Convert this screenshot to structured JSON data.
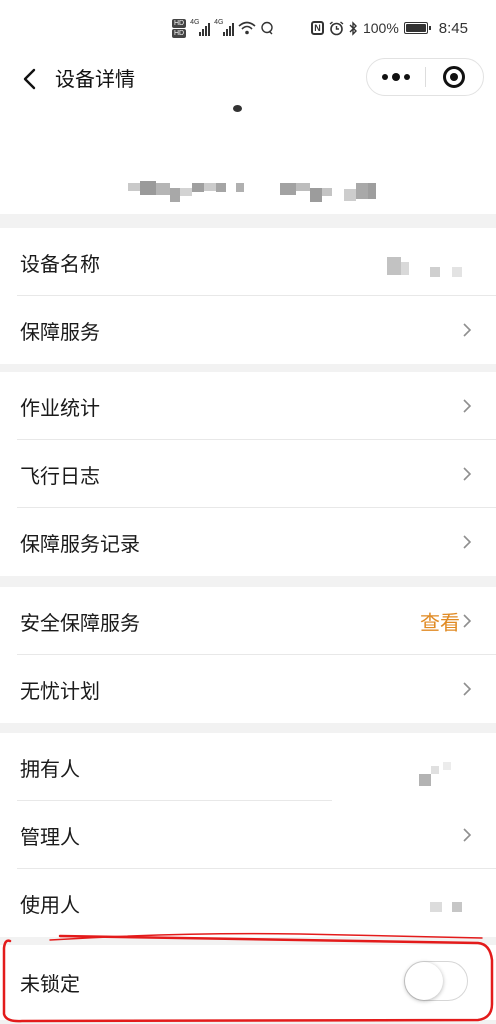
{
  "status_bar": {
    "hd_badge": "HD",
    "network_type": "4G",
    "battery_percent": "100%",
    "time": "8:45",
    "icons": [
      "hd-icon",
      "signal-icon",
      "wifi-icon",
      "nfc-icon",
      "alarm-icon",
      "bluetooth-icon",
      "battery-icon"
    ]
  },
  "navbar": {
    "title": "设备详情",
    "back_icon": "chevron-left-icon",
    "capsule": {
      "more_icon": "more-dots-icon",
      "close_icon": "target-circle-icon"
    }
  },
  "sections": [
    {
      "rows": [
        {
          "label": "设备名称",
          "value_redacted": true,
          "chevron": false
        },
        {
          "label": "保障服务",
          "chevron": true
        }
      ]
    },
    {
      "rows": [
        {
          "label": "作业统计",
          "chevron": true
        },
        {
          "label": "飞行日志",
          "chevron": true
        },
        {
          "label": "保障服务记录",
          "chevron": true
        }
      ]
    },
    {
      "rows": [
        {
          "label": "安全保障服务",
          "link_text": "查看",
          "chevron": true
        },
        {
          "label": "无忧计划",
          "chevron": true
        }
      ]
    },
    {
      "rows": [
        {
          "label": "拥有人",
          "value_redacted": true,
          "chevron": false
        },
        {
          "label": "管理人",
          "chevron": true
        },
        {
          "label": "使用人",
          "value_redacted": true,
          "chevron": false
        }
      ]
    },
    {
      "rows": [
        {
          "label": "未锁定",
          "toggle": {
            "on": false
          }
        }
      ]
    }
  ],
  "colors": {
    "accent_orange": "#e08a23",
    "annotation_red": "#e31b1b",
    "page_background": "#f2f2f2",
    "chevron_gray": "#8f8f8f"
  }
}
